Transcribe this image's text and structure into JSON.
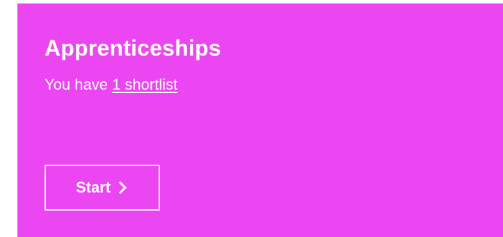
{
  "card": {
    "title": "Apprenticeships",
    "message_prefix": "You have ",
    "shortlist_link": "1 shortlist",
    "background_color": "#ec46f2"
  },
  "start_button": {
    "label": "Start",
    "icon": "chevron-right-icon"
  }
}
